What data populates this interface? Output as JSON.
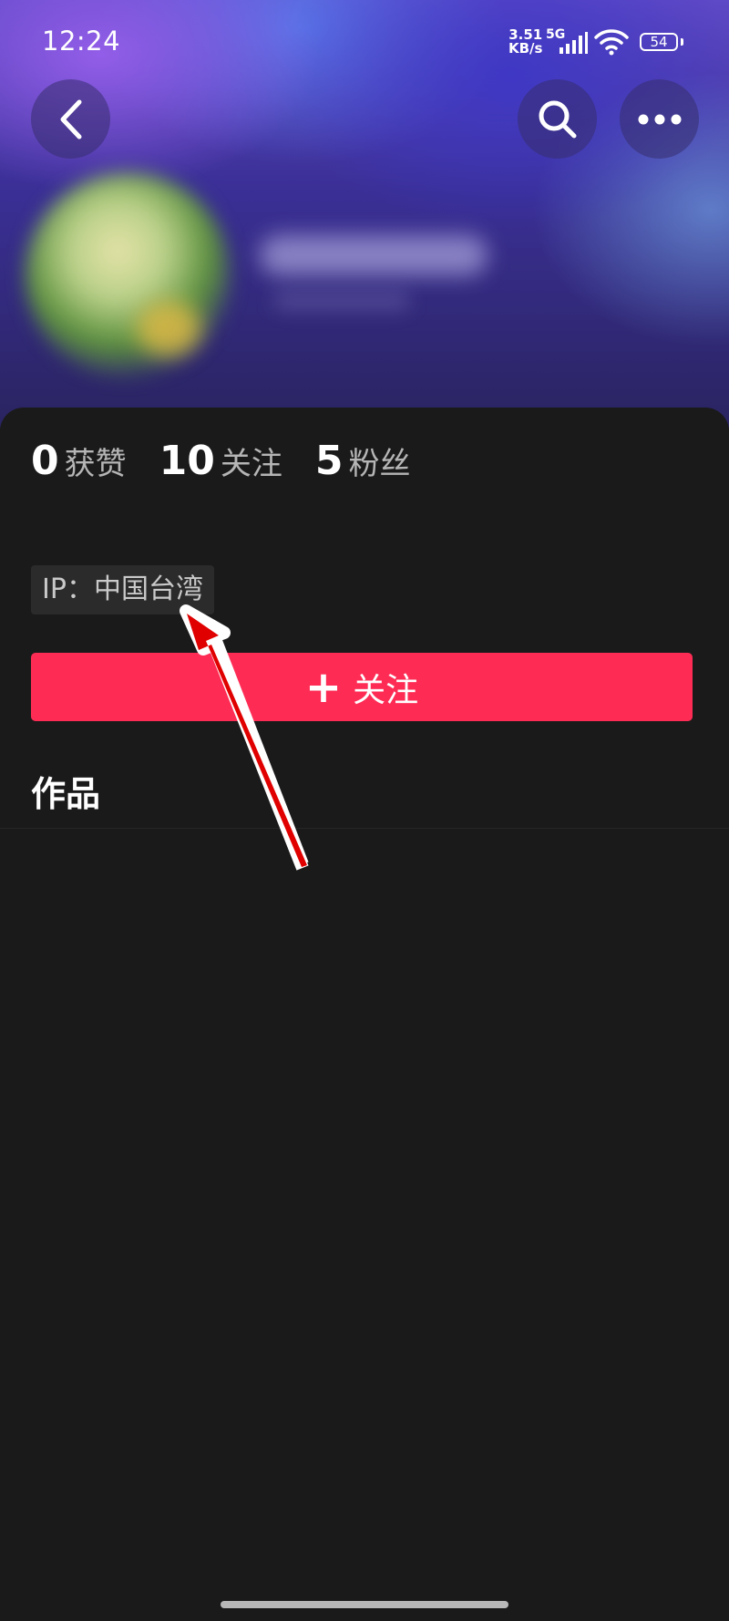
{
  "status_bar": {
    "time": "12:24",
    "net_speed_value": "3.51",
    "net_speed_unit": "KB/s",
    "network_type": "5G",
    "battery": "54"
  },
  "profile": {
    "stats": [
      {
        "value": "0",
        "label": "获赞"
      },
      {
        "value": "10",
        "label": "关注"
      },
      {
        "value": "5",
        "label": "粉丝"
      }
    ],
    "ip_location": "IP：中国台湾",
    "follow_plus": "+",
    "follow_label": "关注",
    "works_tab": "作品"
  },
  "colors": {
    "accent": "#fe2c55",
    "background": "#1a1a1a",
    "annotation_arrow": "#e00000"
  },
  "icons": [
    "back-arrow-icon",
    "search-icon",
    "more-dots-icon",
    "signal-icon",
    "wifi-icon",
    "battery-icon"
  ]
}
